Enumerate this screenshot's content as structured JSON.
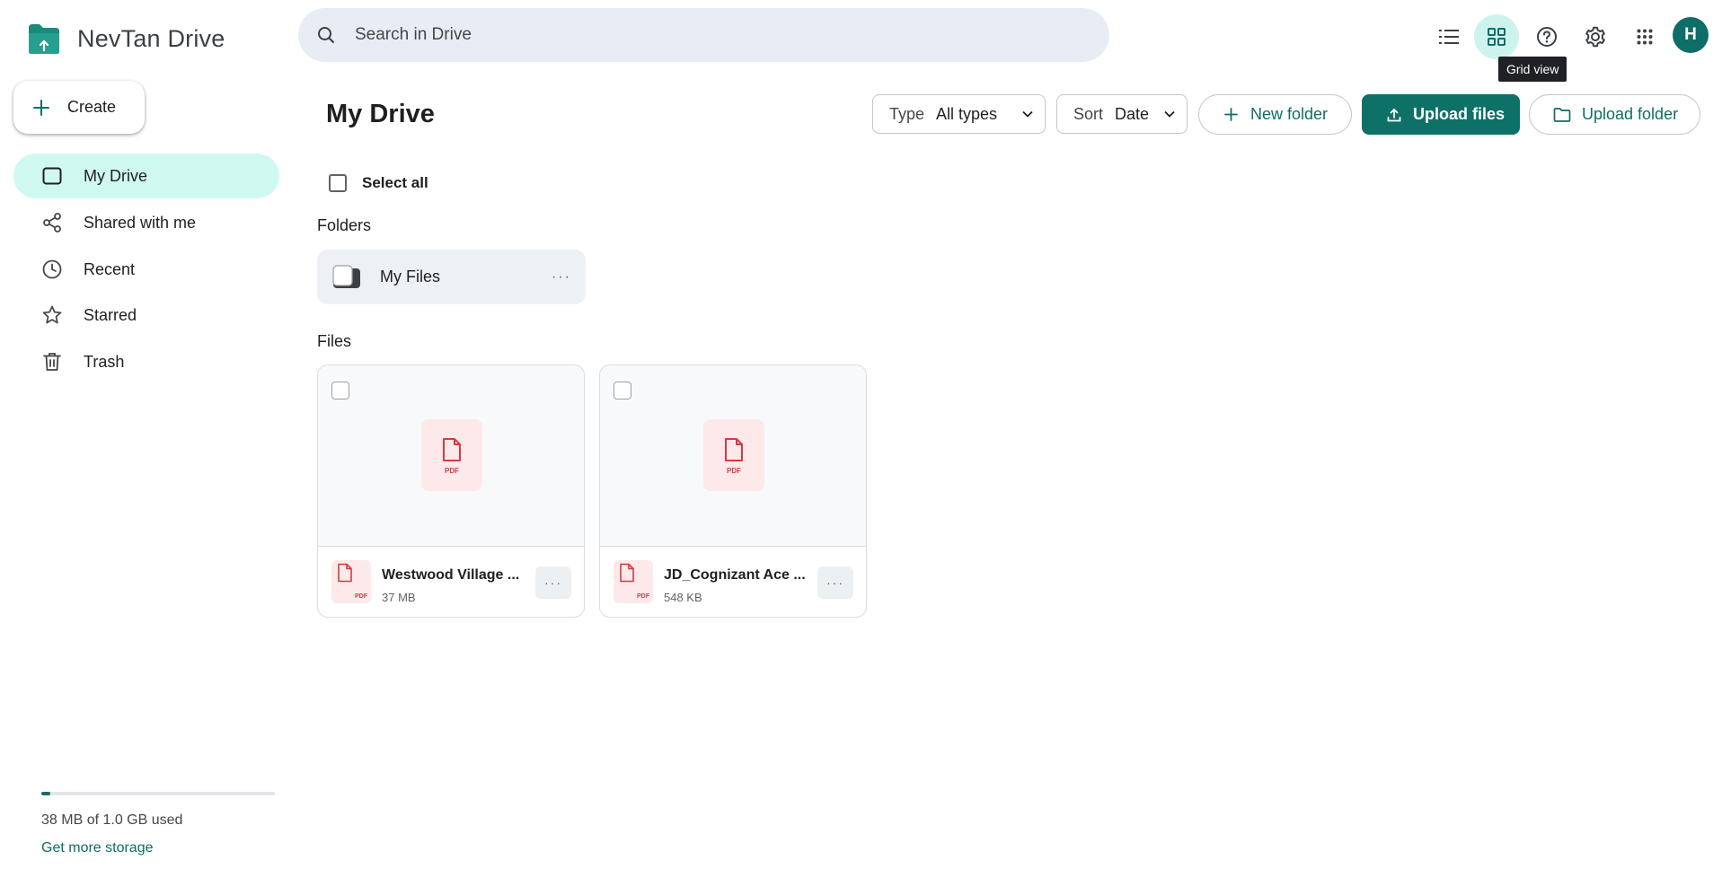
{
  "app": {
    "title": "NevTan Drive",
    "brand_color": "#0d6e67",
    "active_bg": "#cff8f0"
  },
  "search": {
    "placeholder": "Search in Drive"
  },
  "toolbar": {
    "tooltip": "Grid view",
    "avatar_letter": "H",
    "icons": [
      "list-view-icon",
      "grid-view-icon",
      "help-icon",
      "settings-icon",
      "apps-icon"
    ]
  },
  "sidebar": {
    "create_label": "Create",
    "items": [
      {
        "label": "My Drive",
        "icon": "drive-icon",
        "active": true
      },
      {
        "label": "Shared with me",
        "icon": "share-icon"
      },
      {
        "label": "Recent",
        "icon": "clock-icon"
      },
      {
        "label": "Starred",
        "icon": "star-icon"
      },
      {
        "label": "Trash",
        "icon": "trash-icon"
      }
    ],
    "storage": {
      "used_fraction": 0.037,
      "text": "38 MB of 1.0 GB used",
      "link": "Get more storage"
    }
  },
  "main": {
    "title": "My Drive",
    "type_filter": {
      "label": "Type",
      "value": "All types"
    },
    "sort": {
      "label": "Sort",
      "value": "Date"
    },
    "new_folder": "New folder",
    "upload_files": "Upload files",
    "upload_folder": "Upload folder",
    "select_all": "Select all",
    "folders_label": "Folders",
    "files_label": "Files",
    "folders": [
      {
        "name": "My Files"
      }
    ],
    "files": [
      {
        "name": "Westwood Village ...",
        "size": "37 MB",
        "type": "PDF"
      },
      {
        "name": "JD_Cognizant Ace ...",
        "size": "548 KB",
        "type": "PDF"
      }
    ]
  }
}
